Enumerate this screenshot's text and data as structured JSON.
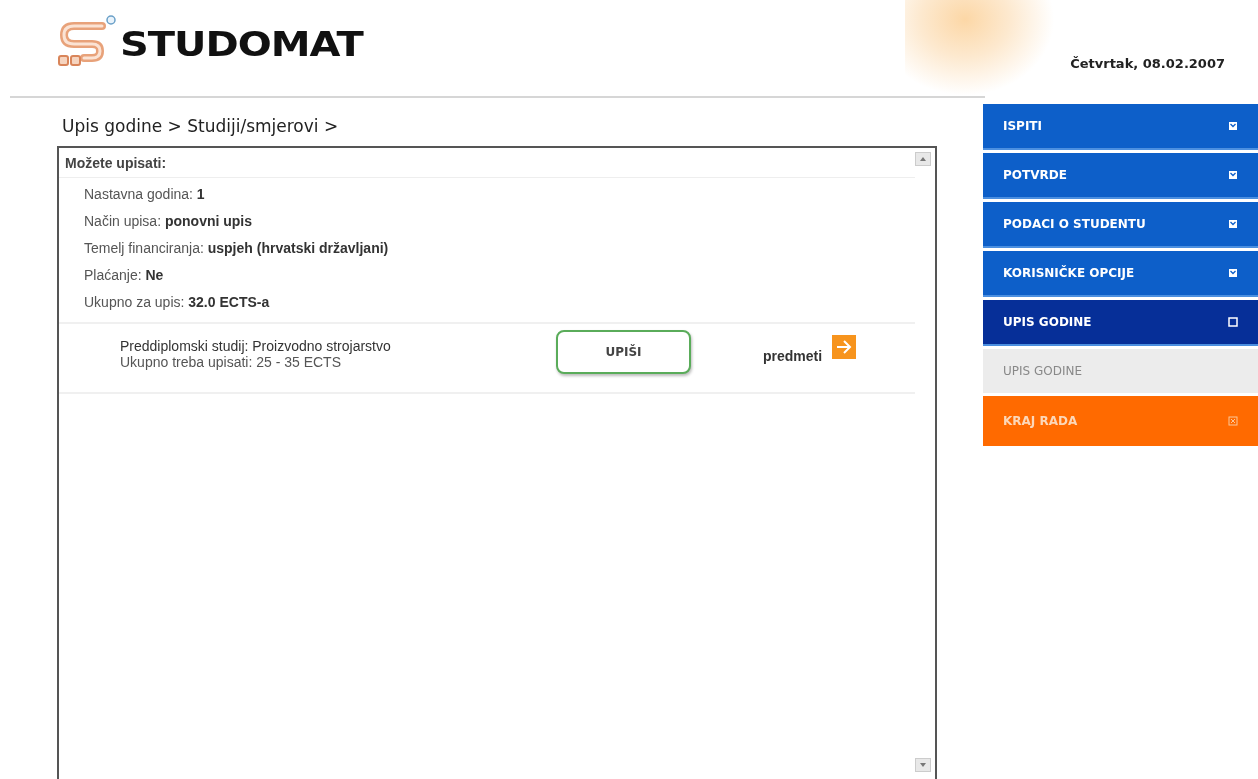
{
  "header": {
    "logo_text": "STUDOMAT",
    "date": "Četvrtak, 08.02.2007"
  },
  "breadcrumb": "Upis godine > Studiji/smjerovi >",
  "panel": {
    "title": "Možete upisati:",
    "fields": [
      {
        "label": "Nastavna godina:",
        "value": "1"
      },
      {
        "label": "Način upisa:",
        "value": "ponovni upis"
      },
      {
        "label": "Temelj financiranja:",
        "value": "uspjeh (hrvatski državljani)"
      },
      {
        "label": "Plaćanje:",
        "value": "Ne"
      },
      {
        "label": "Ukupno za upis:",
        "value": "32.0 ECTS-a"
      }
    ],
    "programs": [
      {
        "title": "Preddiplomski studij: Proizvodno strojarstvo",
        "subtitle": "Ukupno treba upisati: 25 - 35 ECTS",
        "button": "UPIŠI",
        "link": "predmeti"
      }
    ]
  },
  "sidebar": {
    "items": [
      {
        "label": "ISPITI",
        "kind": "section",
        "selected": false
      },
      {
        "label": "POTVRDE",
        "kind": "section",
        "selected": false
      },
      {
        "label": "PODACI O STUDENTU",
        "kind": "section",
        "selected": false
      },
      {
        "label": "KORISNIČKE OPCIJE",
        "kind": "section",
        "selected": false
      },
      {
        "label": "UPIS GODINE",
        "kind": "section",
        "selected": true
      },
      {
        "label": "UPIS GODINE",
        "kind": "sub",
        "selected": false
      },
      {
        "label": "KRAJ RADA",
        "kind": "logout",
        "selected": false
      }
    ]
  }
}
